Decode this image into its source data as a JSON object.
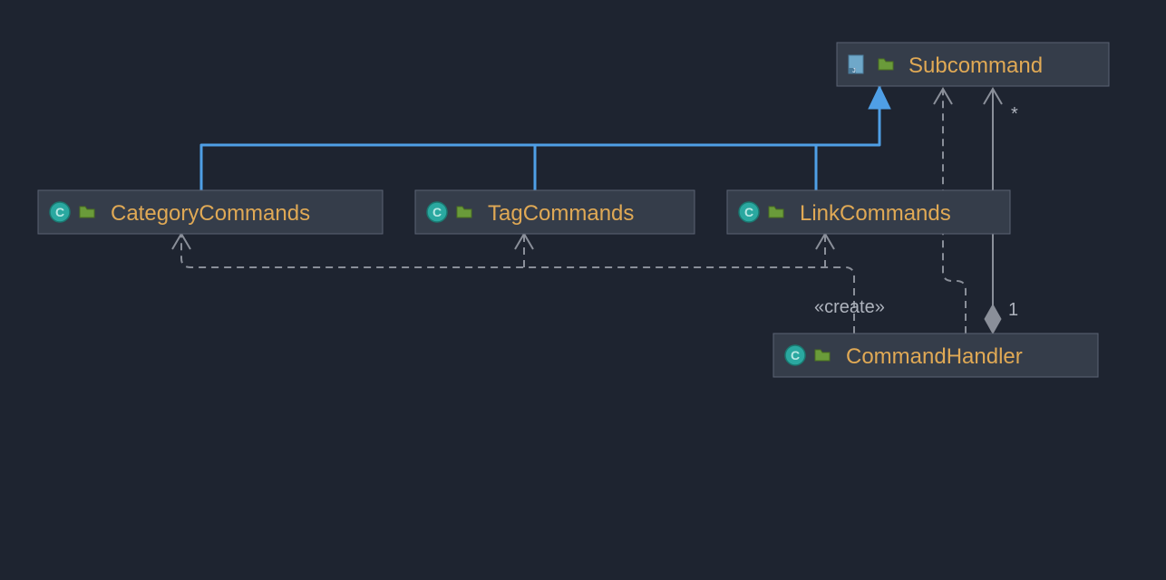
{
  "nodes": {
    "subcommand": {
      "label": "Subcommand",
      "kind": "interface"
    },
    "category": {
      "label": "CategoryCommands",
      "kind": "class"
    },
    "tag": {
      "label": "TagCommands",
      "kind": "class"
    },
    "link": {
      "label": "LinkCommands",
      "kind": "class"
    },
    "handler": {
      "label": "CommandHandler",
      "kind": "class"
    }
  },
  "edges": {
    "create_stereotype": "«create»",
    "multiplicity_star": "*",
    "multiplicity_one": "1"
  },
  "colors": {
    "background": "#1e2430",
    "node_fill": "#353d4a",
    "node_stroke": "#5a6273",
    "label": "#e0a955",
    "inheritance": "#4f9fe6",
    "dependency": "#8a8f99",
    "class_icon": "#2aa8a0",
    "interface_icon": "#4aa3d9",
    "package_icon": "#6a9b3a"
  }
}
